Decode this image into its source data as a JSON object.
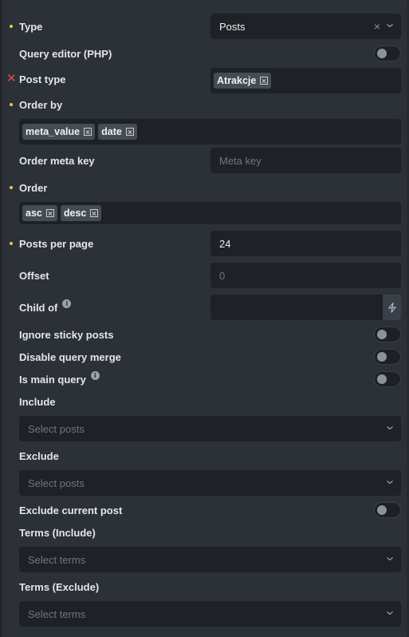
{
  "fields": {
    "type": {
      "label": "Type",
      "value": "Posts"
    },
    "query_editor": {
      "label": "Query editor (PHP)"
    },
    "post_type": {
      "label": "Post type",
      "tags": [
        "Atrakcje"
      ]
    },
    "order_by": {
      "label": "Order by",
      "tags": [
        "meta_value",
        "date"
      ]
    },
    "order_meta_key": {
      "label": "Order meta key",
      "placeholder": "Meta key"
    },
    "order": {
      "label": "Order",
      "tags": [
        "asc",
        "desc"
      ]
    },
    "posts_per_page": {
      "label": "Posts per page",
      "value": "24"
    },
    "offset": {
      "label": "Offset",
      "placeholder": "0"
    },
    "child_of": {
      "label": "Child of"
    },
    "ignore_sticky": {
      "label": "Ignore sticky posts"
    },
    "disable_merge": {
      "label": "Disable query merge"
    },
    "is_main_query": {
      "label": "Is main query"
    },
    "include": {
      "label": "Include",
      "placeholder": "Select posts"
    },
    "exclude": {
      "label": "Exclude",
      "placeholder": "Select posts"
    },
    "exclude_current": {
      "label": "Exclude current post"
    },
    "terms_include": {
      "label": "Terms (Include)",
      "placeholder": "Select terms"
    },
    "terms_exclude": {
      "label": "Terms (Exclude)",
      "placeholder": "Select terms"
    }
  },
  "icons": {
    "info": "i",
    "clear": "×"
  },
  "colors": {
    "required_dot": "#f5c542",
    "error_x": "#e0484f",
    "panel_bg": "#2c3137",
    "input_bg": "#1e2226",
    "tag_bg": "#454c54"
  }
}
